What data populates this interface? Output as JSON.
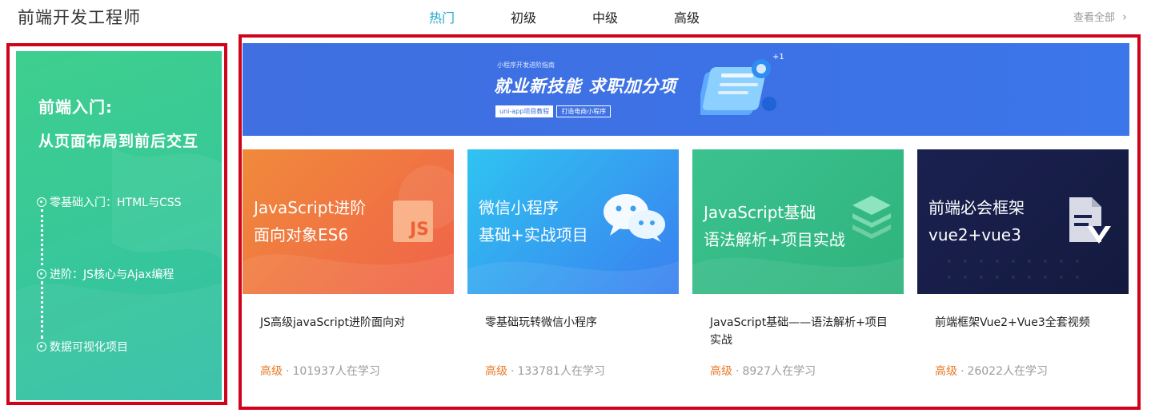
{
  "header": {
    "title": "前端开发工程师",
    "tabs": [
      {
        "label": "热门",
        "active": true
      },
      {
        "label": "初级",
        "active": false
      },
      {
        "label": "中级",
        "active": false
      },
      {
        "label": "高级",
        "active": false
      }
    ],
    "view_all": "查看全部",
    "view_all_icon": "chevron-right-icon"
  },
  "colors": {
    "accent": "#1ba7c9",
    "highlight_frame": "#d0031b",
    "level_text": "#e87b29",
    "banner": "#3f6fe0"
  },
  "path_panel": {
    "title_line1": "前端入门:",
    "title_line2": "从页面布局到前后交互",
    "steps": [
      "零基础入门：HTML与CSS",
      "进阶：JS核心与Ajax编程",
      "数据可视化项目"
    ]
  },
  "banner": {
    "small_text": "小程序开发进阶指南",
    "headline": "就业新技能 求职加分项",
    "tag1": "uni-app项目教程",
    "tag2": "打造电商小程序"
  },
  "courses": [
    {
      "cover_line1": "JavaScript进阶",
      "cover_line2": "面向对象ES6",
      "cover_icon": "js-logo-icon",
      "cover_icon_text": "JS",
      "title": "JS高级javaScript进阶面向对",
      "level": "高级",
      "separator": "·",
      "learners": "101937人在学习"
    },
    {
      "cover_line1": "微信小程序",
      "cover_line2": "基础+实战项目",
      "cover_icon": "wechat-icon",
      "title": "零基础玩转微信小程序",
      "level": "高级",
      "separator": "·",
      "learners": "133781人在学习"
    },
    {
      "cover_line1": "JavaScript基础",
      "cover_line2": "语法解析+项目实战",
      "cover_icon": "layers-icon",
      "title": "JavaScript基础——语法解析+项目实战",
      "level": "高级",
      "separator": "·",
      "learners": "8927人在学习"
    },
    {
      "cover_line1": "前端必会框架",
      "cover_line2": "vue2+vue3",
      "cover_icon": "vue-document-icon",
      "title": "前端框架Vue2+Vue3全套视频",
      "level": "高级",
      "separator": "·",
      "learners": "26022人在学习"
    }
  ]
}
